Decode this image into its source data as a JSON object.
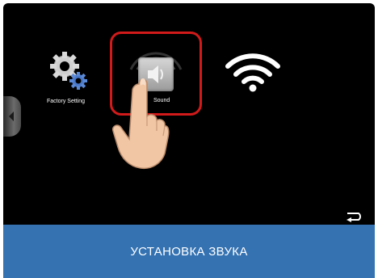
{
  "apps": {
    "factory_label": "Factory Setting",
    "factory_icon": "gears-icon",
    "sound_label": "Sound",
    "sound_icon": "speaker-icon",
    "wifi_icon": "wifi-icon"
  },
  "nav": {
    "side_tab_icon": "chevron-left-icon",
    "back_icon": "back-arrow-icon"
  },
  "overlay": {
    "hand_icon": "pointing-hand-icon",
    "highlight_color": "#d11a1a"
  },
  "caption": {
    "text": "УСТАНОВКА ЗВУКА",
    "background": "#3472b2"
  }
}
